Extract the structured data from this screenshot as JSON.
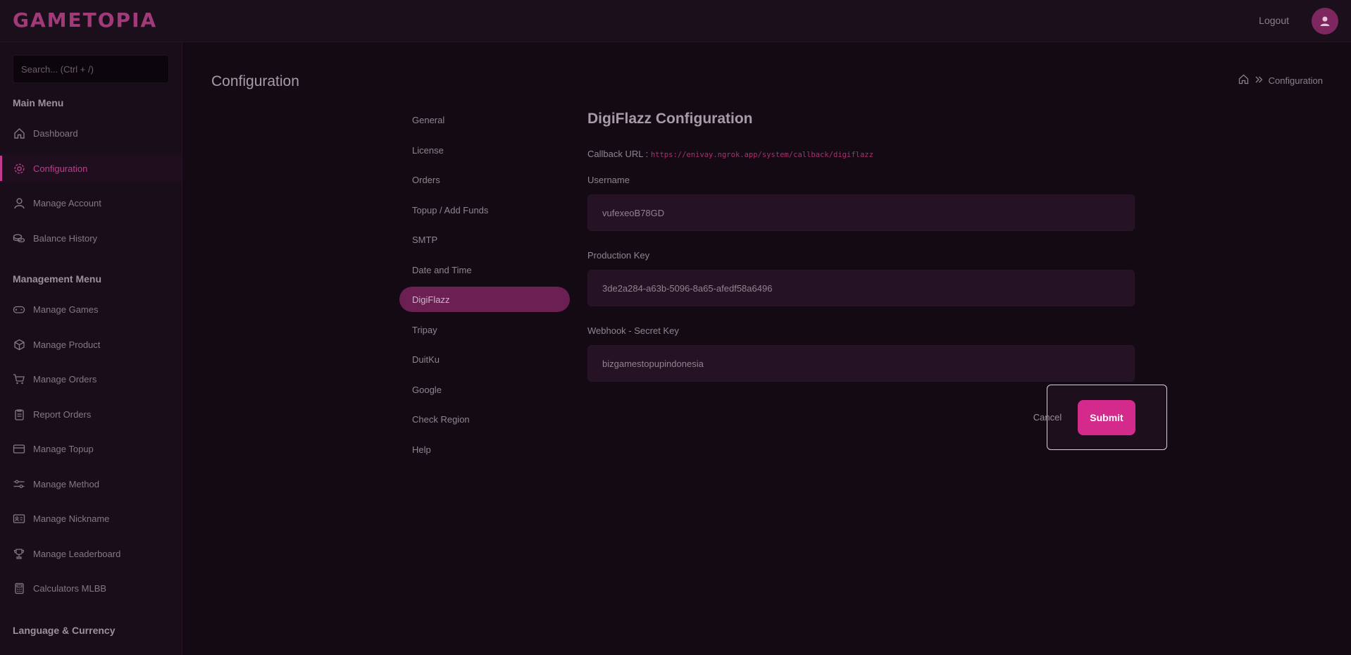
{
  "app": {
    "logo": "GAMETOPIA",
    "logout_label": "Logout"
  },
  "sidebar": {
    "search_placeholder": "Search... (Ctrl + /)",
    "sections": {
      "main": "Main Menu",
      "management": "Management Menu",
      "language": "Language & Currency"
    },
    "items": [
      {
        "label": "Dashboard",
        "icon": "home-icon"
      },
      {
        "label": "Configuration",
        "icon": "gear-icon",
        "active": true
      },
      {
        "label": "Manage Account",
        "icon": "user-icon"
      },
      {
        "label": "Balance History",
        "icon": "coins-icon"
      },
      {
        "label": "Manage Games",
        "icon": "gamepad-icon"
      },
      {
        "label": "Manage Product",
        "icon": "box-icon"
      },
      {
        "label": "Manage Orders",
        "icon": "cart-icon"
      },
      {
        "label": "Report Orders",
        "icon": "clipboard-icon"
      },
      {
        "label": "Manage Topup",
        "icon": "card-icon"
      },
      {
        "label": "Manage Method",
        "icon": "sliders-icon"
      },
      {
        "label": "Manage Nickname",
        "icon": "id-card-icon"
      },
      {
        "label": "Manage Leaderboard",
        "icon": "trophy-icon"
      },
      {
        "label": "Calculators MLBB",
        "icon": "calculator-icon"
      }
    ]
  },
  "page": {
    "title": "Configuration",
    "breadcrumb": {
      "current": "Configuration"
    }
  },
  "config_nav": [
    {
      "label": "General"
    },
    {
      "label": "License"
    },
    {
      "label": "Orders"
    },
    {
      "label": "Topup / Add Funds"
    },
    {
      "label": "SMTP"
    },
    {
      "label": "Date and Time"
    },
    {
      "label": "DigiFlazz",
      "active": true
    },
    {
      "label": "Tripay"
    },
    {
      "label": "DuitKu"
    },
    {
      "label": "Google"
    },
    {
      "label": "Check Region"
    },
    {
      "label": "Help"
    }
  ],
  "form": {
    "title": "DigiFlazz Configuration",
    "callback_label": "Callback URL :",
    "callback_url": "https://enivay.ngrok.app/system/callback/digiflazz",
    "username_label": "Username",
    "username_value": "vufexeoB78GD",
    "production_key_label": "Production Key",
    "production_key_value": "3de2a284-a63b-5096-8a65-afedf58a6496",
    "webhook_label": "Webhook - Secret Key",
    "webhook_value": "bizgamestopupindonesia",
    "cancel_label": "Cancel",
    "submit_label": "Submit"
  },
  "colors": {
    "accent": "#d32a8c",
    "background": "#140a14",
    "sidebar": "#1a0d1a",
    "active_nav": "#6b1f52"
  }
}
